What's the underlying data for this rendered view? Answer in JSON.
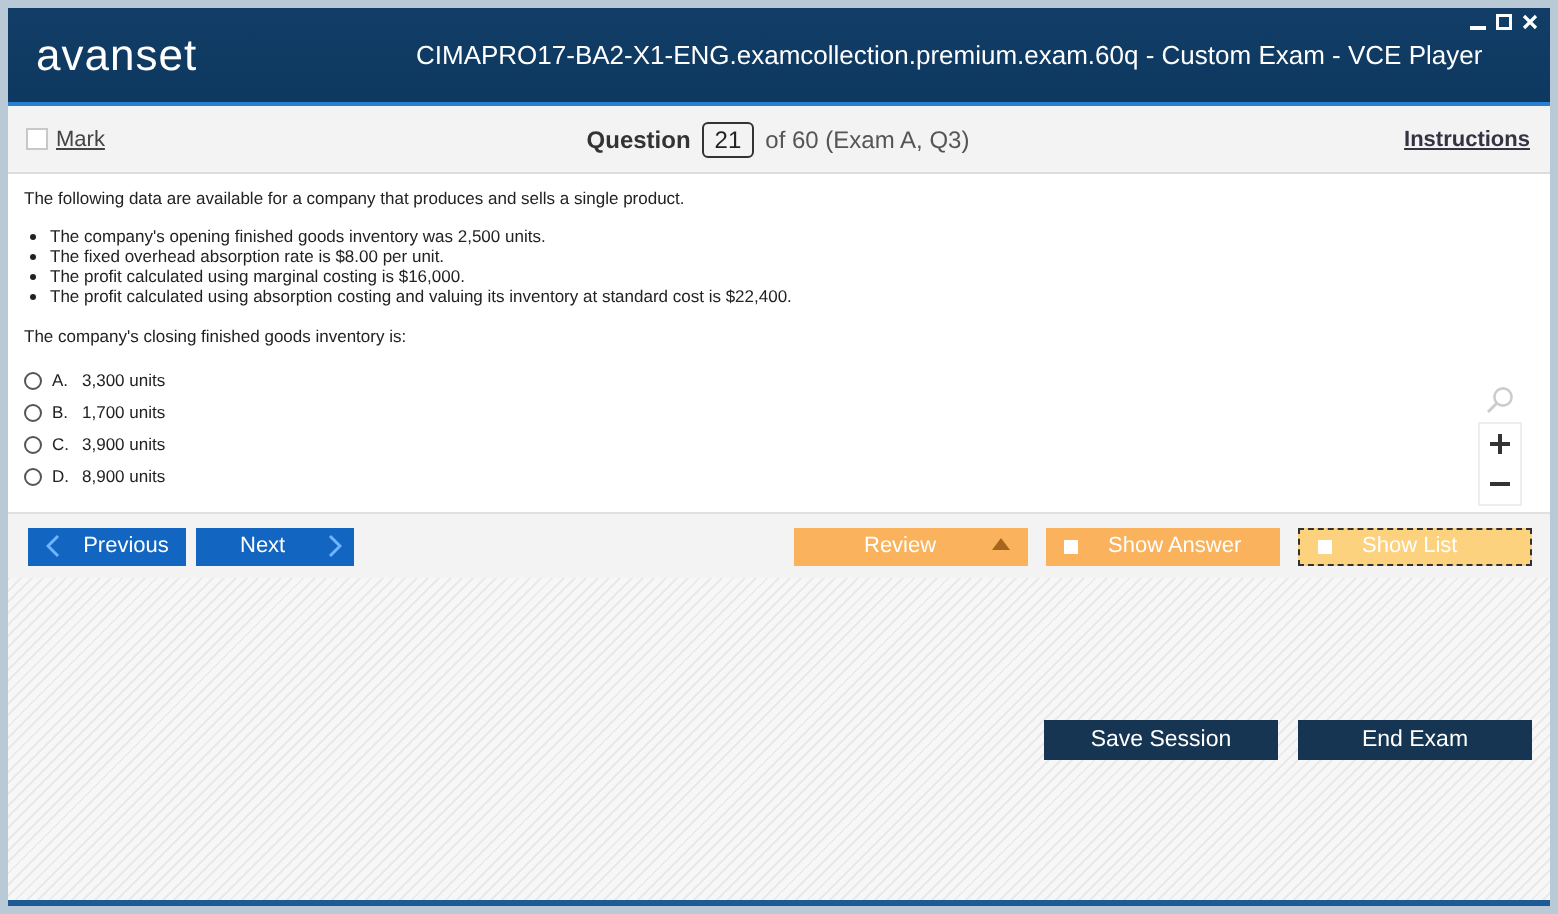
{
  "window": {
    "logo": "avanset",
    "title": "CIMAPRO17-BA2-X1-ENG.examcollection.premium.exam.60q - Custom Exam - VCE Player"
  },
  "toolbar": {
    "mark": {
      "label": "Mark",
      "checked": false
    },
    "question_label": "Question",
    "question_number": "21",
    "question_of": "of 60 (Exam A, Q3)",
    "instructions": "Instructions"
  },
  "question": {
    "intro": "The following data are available for a company that produces and sells a single product.",
    "bullets": [
      "The company's opening finished goods inventory was 2,500 units.",
      "The fixed overhead absorption rate is $8.00 per unit.",
      "The profit calculated using marginal costing is $16,000.",
      "The profit calculated using absorption costing and valuing its inventory at standard cost is $22,400."
    ],
    "prompt": "The company's closing finished goods inventory is:",
    "options": [
      {
        "letter": "A.",
        "text": "3,300 units",
        "selected": false
      },
      {
        "letter": "B.",
        "text": "1,700 units",
        "selected": false
      },
      {
        "letter": "C.",
        "text": "3,900 units",
        "selected": false
      },
      {
        "letter": "D.",
        "text": "8,900 units",
        "selected": false
      }
    ]
  },
  "nav": {
    "previous": "Previous",
    "next": "Next",
    "review": "Review",
    "show_answer": {
      "label": "Show Answer",
      "checked": false
    },
    "show_list": {
      "label": "Show List",
      "checked": false
    }
  },
  "footer": {
    "buttons": [
      "Save Session",
      "End Exam"
    ]
  }
}
